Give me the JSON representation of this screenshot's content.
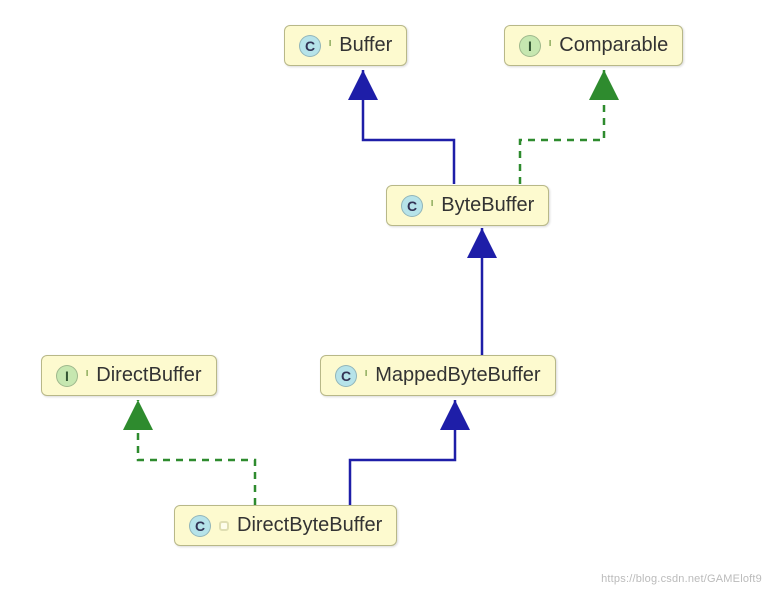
{
  "nodes": {
    "buffer": {
      "kind": "class-abstract",
      "letter": "C",
      "label": "Buffer"
    },
    "comparable": {
      "kind": "interface",
      "letter": "I",
      "label": "Comparable"
    },
    "bytebuffer": {
      "kind": "class-abstract",
      "letter": "C",
      "label": "ByteBuffer"
    },
    "directbuffer": {
      "kind": "interface",
      "letter": "I",
      "label": "DirectBuffer"
    },
    "mappedbb": {
      "kind": "class-abstract",
      "letter": "C",
      "label": "MappedByteBuffer"
    },
    "directbb": {
      "kind": "class",
      "letter": "C",
      "label": "DirectByteBuffer"
    }
  },
  "edges": [
    {
      "from": "bytebuffer",
      "to": "buffer",
      "type": "extends"
    },
    {
      "from": "bytebuffer",
      "to": "comparable",
      "type": "implements"
    },
    {
      "from": "mappedbb",
      "to": "bytebuffer",
      "type": "extends"
    },
    {
      "from": "directbb",
      "to": "mappedbb",
      "type": "extends"
    },
    {
      "from": "directbb",
      "to": "directbuffer",
      "type": "implements"
    }
  ],
  "legend": {
    "extends_color": "#1e1ea8",
    "implements_color": "#2e8b2e"
  },
  "watermark": "https://blog.csdn.net/GAMEloft9"
}
